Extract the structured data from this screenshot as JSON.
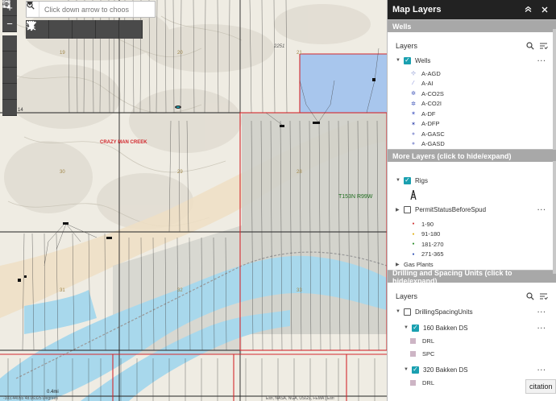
{
  "map": {
    "section_labels": [
      "19",
      "20",
      "21",
      "30",
      "29",
      "28",
      "31",
      "32",
      "33"
    ],
    "road_label": "2251",
    "creek_label": "CRAZY MAN CREEK",
    "township_label": "T153N R99W",
    "scale_text": "0.4mi",
    "left_edge_text": "14",
    "footer_text": "-103.44055  48.06325 Degrees",
    "footer_text2": "Esri, NASA, NGA, USGS, FEMA | Esri"
  },
  "search": {
    "placeholder": "Click down arrow to choos"
  },
  "panel": {
    "title": "Map Layers",
    "sections": [
      {
        "title": "Wells",
        "layers_heading": "Layers",
        "layer": "Wells",
        "legend": [
          {
            "label": "A-AGD",
            "color": "#5b6cc0"
          },
          {
            "label": "A-AI",
            "color": "#7f8bd8"
          },
          {
            "label": "A-CO2S",
            "color": "#3f55b8"
          },
          {
            "label": "A-CO2I",
            "color": "#3f55b8"
          },
          {
            "label": "A-DF",
            "color": "#5060c5"
          },
          {
            "label": "A-DFP",
            "color": "#3e4fb0"
          },
          {
            "label": "A-GASC",
            "color": "#9aa2d8"
          },
          {
            "label": "A-GASD",
            "color": "#9aa2d8"
          }
        ]
      },
      {
        "title": "More Layers (click to hide/expand)",
        "layers": [
          {
            "label": "Rigs",
            "checked": true
          },
          {
            "label": "PermitStatusBeforeSpud",
            "checked": false
          }
        ],
        "permit_legend": [
          {
            "label": "1-90",
            "color": "#d23a3a"
          },
          {
            "label": "91-180",
            "color": "#e2b21a"
          },
          {
            "label": "181-270",
            "color": "#2f8f2f"
          },
          {
            "label": "271-365",
            "color": "#2f4fb5"
          }
        ],
        "extra": "Gas Plants"
      },
      {
        "title": "Drilling and Spacing Units (click to hide/expand)",
        "layers_heading": "Layers",
        "group": "DrillingSpacingUnits",
        "sub": [
          {
            "label": "160 Bakken DS",
            "items": [
              "DRL",
              "SPC"
            ]
          },
          {
            "label": "320 Bakken DS",
            "items": [
              "DRL"
            ]
          }
        ]
      }
    ]
  },
  "citation": "citation"
}
